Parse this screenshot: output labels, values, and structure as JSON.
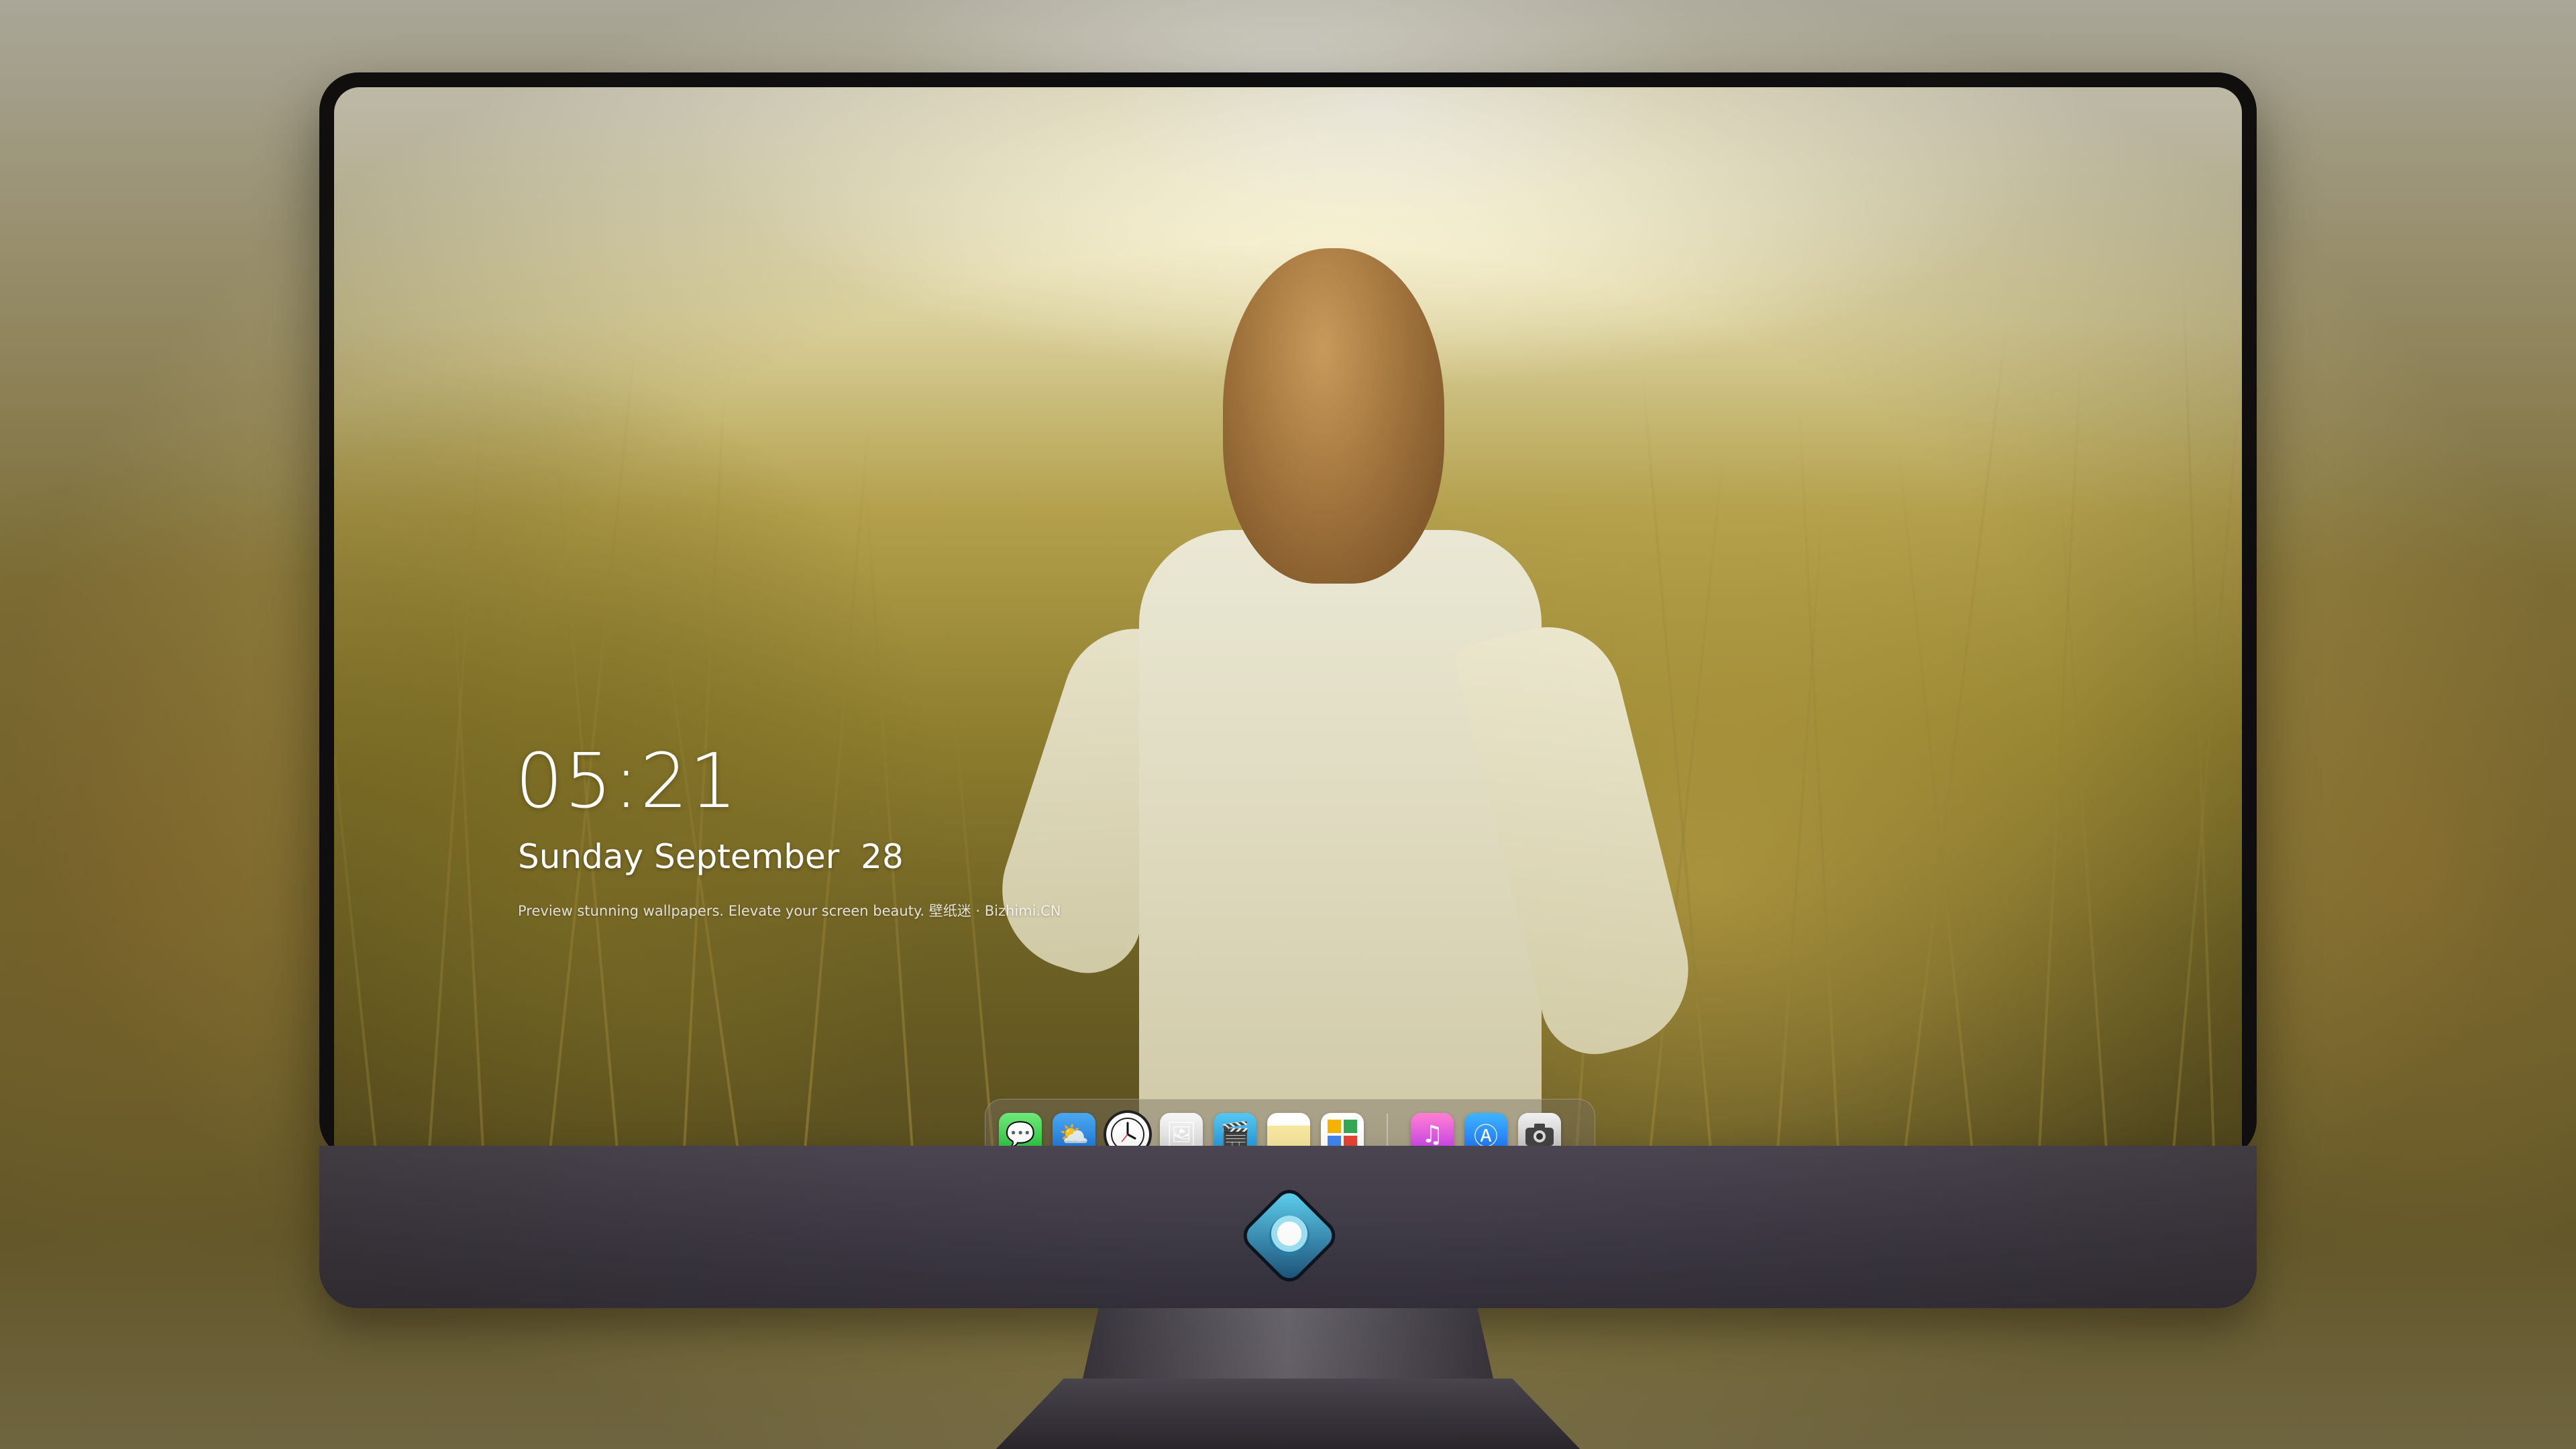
{
  "lock_screen": {
    "time": "05:21",
    "date": "Sunday September  28",
    "tagline": "Preview stunning wallpapers. Elevate your screen beauty. 壁纸迷 · Bizhimi.CN"
  },
  "dock": {
    "apps": [
      {
        "name": "Messages",
        "icon": "message-bubble-icon",
        "glyph": "💬"
      },
      {
        "name": "Weather",
        "icon": "cloud-sun-icon",
        "glyph": "⛅"
      },
      {
        "name": "Clock",
        "icon": "clock-icon",
        "glyph": "🕐"
      },
      {
        "name": "Preview",
        "icon": "image-viewer-icon",
        "glyph": "🖼"
      },
      {
        "name": "Clips",
        "icon": "clapperboard-icon",
        "glyph": "🎬"
      },
      {
        "name": "Notes",
        "icon": "notes-icon",
        "glyph": ""
      },
      {
        "name": "Photos",
        "icon": "photo-grid-icon",
        "glyph": "▦"
      },
      {
        "name": "Music",
        "icon": "music-note-icon",
        "glyph": "♫"
      },
      {
        "name": "App Store",
        "icon": "app-store-icon",
        "glyph": "Ⓐ"
      },
      {
        "name": "Camera",
        "icon": "camera-icon",
        "glyph": "📷"
      }
    ]
  },
  "colors": {
    "bezel": "#0d0c10",
    "chin": "#3d3946",
    "sky": "#f3efdc",
    "grass": "#8f7f2e",
    "text": "#ffffff"
  }
}
